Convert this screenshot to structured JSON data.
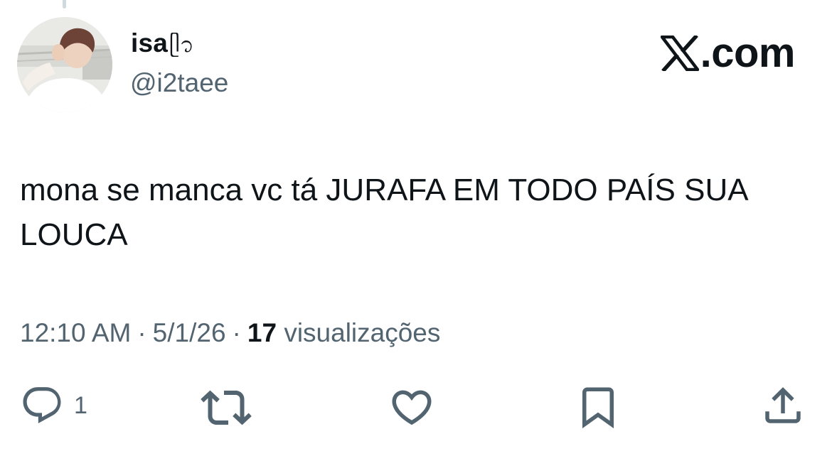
{
  "author": {
    "display_name": "isa",
    "display_emoji": "ᥫ᭡",
    "handle": "@i2taee"
  },
  "brand": {
    "logo_letter": "𝕏",
    "text": ".com"
  },
  "tweet": {
    "text": "mona se manca vc tá JURAFA EM TODO PAÍS SUA LOUCA",
    "time": "12:10 AM",
    "separator": "·",
    "date": "5/1/26",
    "views_count": "17",
    "views_label": "visualizações"
  },
  "actions": {
    "reply_count": "1",
    "icons": [
      "reply-icon",
      "retweet-icon",
      "like-icon",
      "bookmark-icon",
      "share-icon"
    ]
  },
  "colors": {
    "text": "#0f1419",
    "secondary": "#536471",
    "background": "#ffffff"
  }
}
